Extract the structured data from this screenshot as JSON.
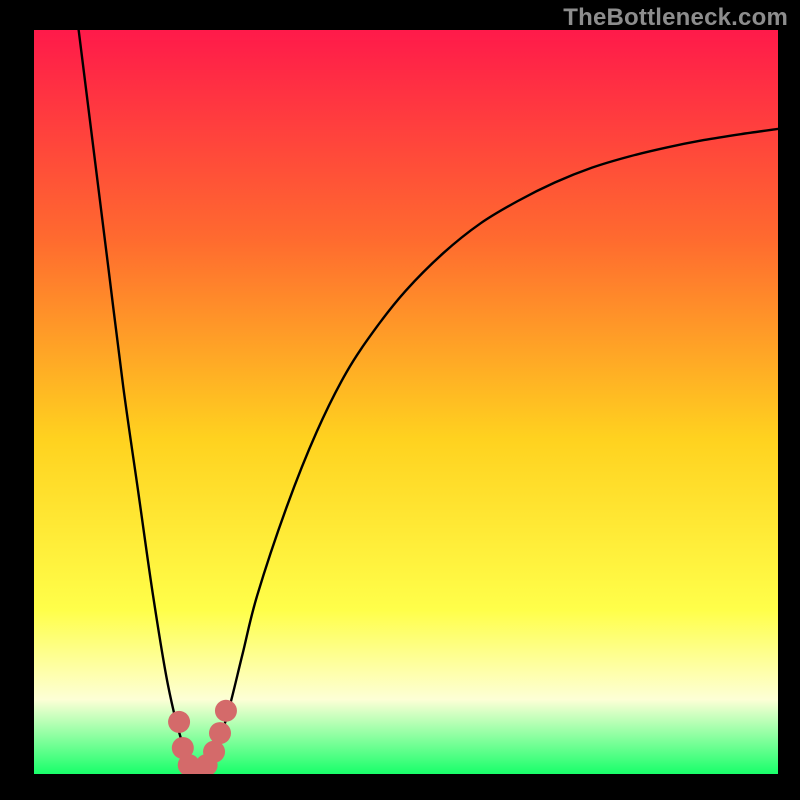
{
  "watermark": "TheBottleneck.com",
  "colors": {
    "frame": "#000000",
    "gradient_top": "#ff1a4a",
    "gradient_mid_upper": "#ff6a2f",
    "gradient_mid": "#ffd21f",
    "gradient_mid_lower": "#ffff4a",
    "gradient_pale": "#fdffd6",
    "gradient_bottom": "#18ff6a",
    "curve": "#000000",
    "marker": "#d46a6a"
  },
  "chart_data": {
    "type": "line",
    "title": "",
    "xlabel": "",
    "ylabel": "",
    "xlim": [
      0,
      100
    ],
    "ylim": [
      0,
      100
    ],
    "series": [
      {
        "name": "bottleneck-curve",
        "x": [
          6,
          8,
          10,
          12,
          14,
          16,
          18,
          20,
          22,
          24,
          26,
          28,
          30,
          34,
          38,
          42,
          46,
          50,
          55,
          60,
          65,
          70,
          75,
          80,
          85,
          90,
          95,
          100
        ],
        "values": [
          100,
          84,
          68,
          52,
          38,
          24,
          12,
          4,
          0,
          2,
          8,
          16,
          24,
          36,
          46,
          54,
          60,
          65,
          70,
          74,
          77,
          79.5,
          81.5,
          83,
          84.2,
          85.2,
          86,
          86.7
        ]
      }
    ],
    "optimum_x": 22,
    "markers": {
      "name": "highlight-dots",
      "x": [
        19.5,
        20.0,
        20.8,
        22.0,
        23.2,
        24.2,
        25.0,
        25.8
      ],
      "y": [
        7.0,
        3.5,
        1.2,
        0.4,
        1.2,
        3.0,
        5.5,
        8.5
      ]
    }
  }
}
